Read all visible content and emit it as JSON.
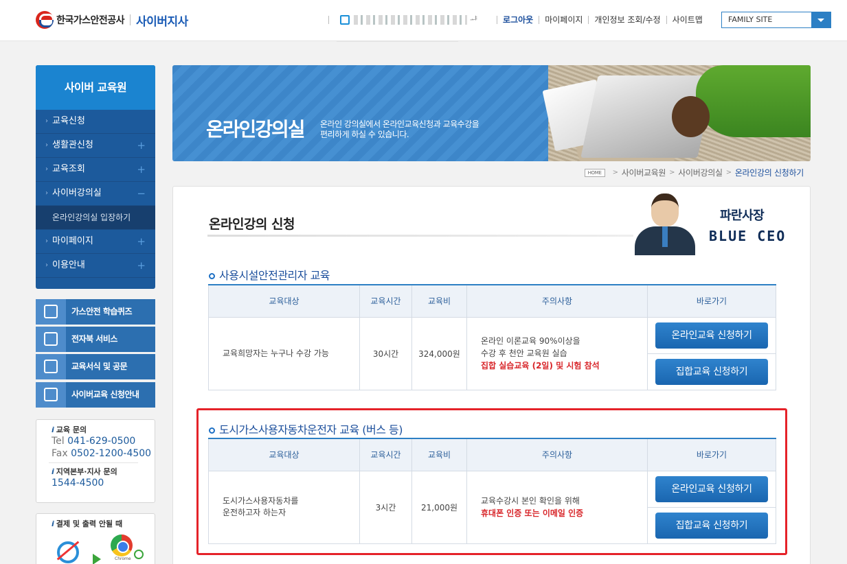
{
  "header": {
    "logo_company": "한국가스안전공사",
    "logo_sub": "사이버지사",
    "user_suffix": "ᆦ",
    "nav": {
      "logout": "로그아웃",
      "mypage": "마이페이지",
      "profile": "개인정보 조회/수정",
      "sitemap": "사이트맵"
    },
    "family_site": "FAMILY SITE"
  },
  "sidebar": {
    "title": "사이버 교육원",
    "items": [
      {
        "label": "교육신청",
        "toggle": ""
      },
      {
        "label": "생활관신청",
        "toggle": "+"
      },
      {
        "label": "교육조회",
        "toggle": "+"
      },
      {
        "label": "사이버강의실",
        "toggle": "−"
      },
      {
        "label": "마이페이지",
        "toggle": "+"
      },
      {
        "label": "이용안내",
        "toggle": "+"
      }
    ],
    "subitem": "온라인강의실 입장하기",
    "quick_links": [
      "가스안전 학습퀴즈",
      "전자북 서비스",
      "교육서식 및 공문",
      "사이버교육 신청안내"
    ],
    "contact": {
      "edu_head": "교육 문의",
      "tel": "041-629-0500",
      "tel_label": "Tel",
      "fax": "0502-1200-4500",
      "fax_label": "Fax",
      "region_head": "지역본부·지사 문의",
      "region_tel": "1544-4500"
    },
    "print_head": "결제 및 출력 안될 때",
    "chrome_label": "Chrome"
  },
  "banner": {
    "title": "온라인강의실",
    "desc_line1": "온라인 강의실에서 온라인교육신청과 교육수강을",
    "desc_line2": "편리하게 하실 수 있습니다."
  },
  "breadcrumb": {
    "home": "HOME",
    "arrow": ">",
    "items": [
      "사이버교육원",
      "사이버강의실",
      "온라인강의 신청하기"
    ]
  },
  "main": {
    "title": "온라인강의 신청",
    "ceo_kor": "파란사장",
    "ceo_eng": "BLUE CEO",
    "columns": [
      "교육대상",
      "교육시간",
      "교육비",
      "주의사항",
      "바로가기"
    ],
    "courses": [
      {
        "title": "사용시설안전관리자 교육",
        "target_line1": "교육희망자는 누구나 수강 가능",
        "target_line2": "",
        "hours": "30시간",
        "fee": "324,000원",
        "note_line1": "온라인 이론교육 90%이상을",
        "note_line2": "수강 후 천안 교육원 실습",
        "note_red": "집합 실습교육 (2일) 및 시험 참석",
        "online_btn": "온라인교육 신청하기",
        "group_btn": "집합교육 신청하기"
      },
      {
        "title": "도시가스사용자동차운전자 교육 (버스 등)",
        "target_line1": "도시가스사용자동차를",
        "target_line2": "운전하고자 하는자",
        "hours": "3시간",
        "fee": "21,000원",
        "note_line1": "교육수강시 본인 확인을 위해",
        "note_line2": "",
        "note_red": "휴대폰 인증 또는 이메일 인증",
        "online_btn": "온라인교육 신청하기",
        "group_btn": "집합교육 신청하기"
      }
    ]
  },
  "colors": {
    "primary": "#1c5a9c",
    "accent": "#2c7fc4",
    "alert": "#d8262a",
    "highlight": "#e52229"
  }
}
